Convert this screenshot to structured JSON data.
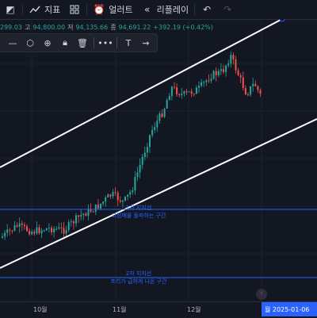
{
  "toolbar": {
    "indicators_label": "지표",
    "alerts_label": "얼러트",
    "replay_label": "리플레이"
  },
  "ohlc": {
    "open_value": "299.03",
    "high_key": "고",
    "high_value": "94,800.00",
    "low_key": "저",
    "low_value": "94,135.66",
    "close_key": "종",
    "close_value": "94,691.22",
    "change_value": "+392.19 (+0.42%)"
  },
  "annotations": {
    "zone1_title": "1차 지지선",
    "zone1_sub": "고점매물 돌파하는 구간",
    "zone2_title": "2차 지지선",
    "zone2_sub": "프리가 급하게 나온 구간"
  },
  "xaxis": {
    "oct": "10월",
    "nov": "11월",
    "dec": "12월",
    "current_date_badge": "월  2025-01-06"
  },
  "colors": {
    "up": "#26a69a",
    "down": "#ef5350",
    "zone_line": "#2962ff",
    "trend_line": "#ffffff"
  },
  "icons": [
    "chart-type-icon",
    "indicators-icon",
    "templates-icon",
    "alert-icon",
    "replay-icon",
    "undo-icon",
    "redo-icon"
  ]
}
